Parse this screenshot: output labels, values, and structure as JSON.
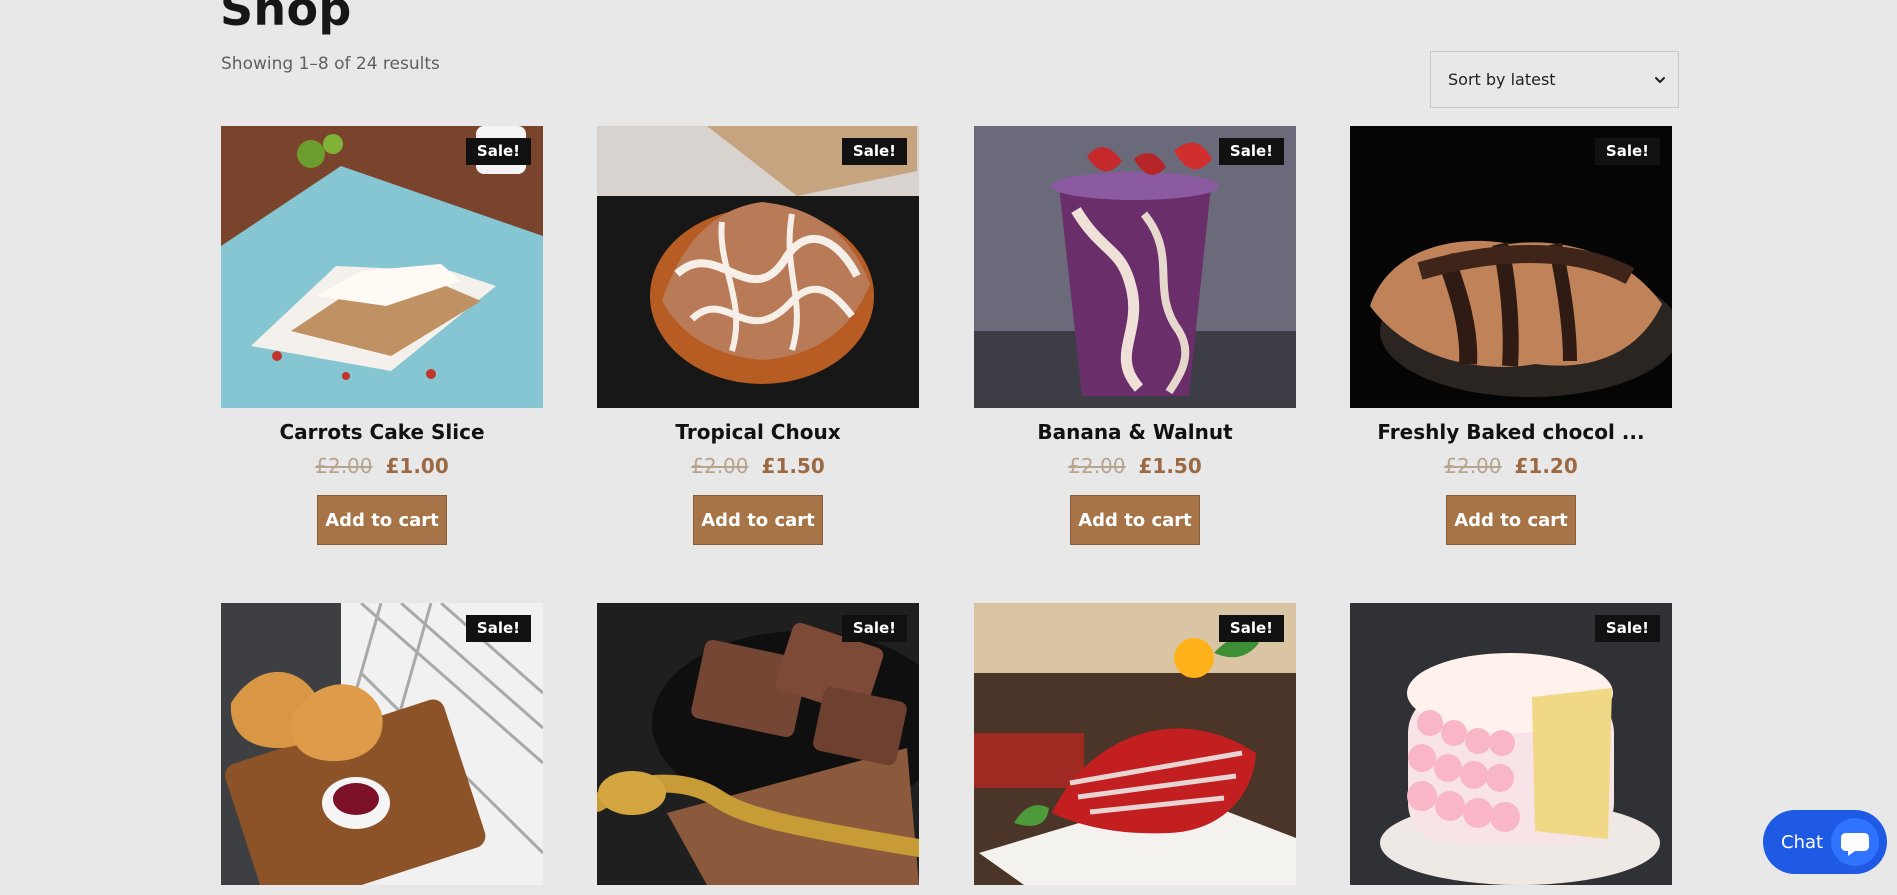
{
  "header": {
    "title": "Shop",
    "result_count": "Showing 1–8 of 24 results",
    "sort_value": "Sort by latest"
  },
  "products": [
    {
      "name": "Carrots Cake Slice",
      "badge": "Sale!",
      "old_price": "£2.00",
      "new_price": "£1.00",
      "button": "Add to cart"
    },
    {
      "name": "Tropical Choux",
      "badge": "Sale!",
      "old_price": "£2.00",
      "new_price": "£1.50",
      "button": "Add to cart"
    },
    {
      "name": "Banana & Walnut",
      "badge": "Sale!",
      "old_price": "£2.00",
      "new_price": "£1.50",
      "button": "Add to cart"
    },
    {
      "name": "Freshly Baked chocol ...",
      "badge": "Sale!",
      "old_price": "£2.00",
      "new_price": "£1.20",
      "button": "Add to cart"
    },
    {
      "name": "",
      "badge": "Sale!"
    },
    {
      "name": "",
      "badge": "Sale!"
    },
    {
      "name": "",
      "badge": "Sale!"
    },
    {
      "name": "",
      "badge": "Sale!"
    }
  ],
  "chat": {
    "label": "Chat"
  },
  "colors": {
    "background": "#e8e8e8",
    "accent_brown": "#a77447",
    "price_brown": "#9b6a45",
    "chat_blue": "#1f5ae4"
  },
  "icons": {
    "sort": "chevron-down-icon",
    "chat": "chat-bubble-icon"
  }
}
